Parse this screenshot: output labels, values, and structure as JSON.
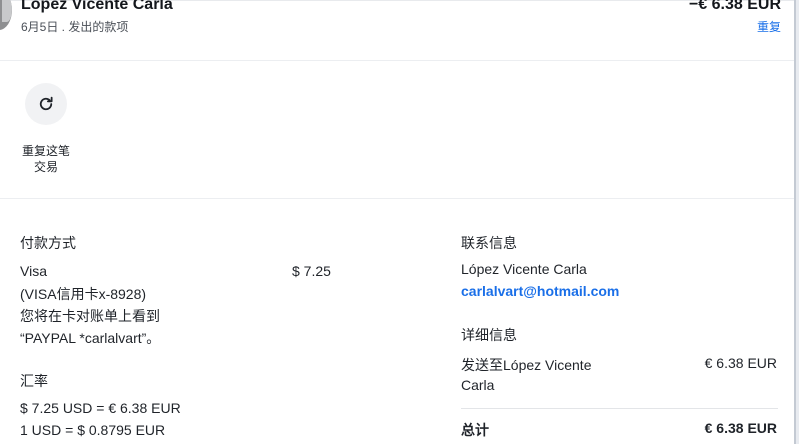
{
  "header": {
    "payee_name": "López Vicente Carla",
    "subtitle": "6月5日 . 发出的款项",
    "amount": "−€ 6.38 EUR",
    "repeat_link": "重复"
  },
  "actions": {
    "repeat_label_line1": "重复这笔",
    "repeat_label_line2": "交易",
    "repeat_icon": "refresh-icon"
  },
  "payment": {
    "heading": "付款方式",
    "method_name": "Visa",
    "card_line": "(VISA信用卡x-8928)",
    "statement_line1": "您将在卡对账单上看到",
    "statement_line2": "“PAYPAL *carlalvart”。",
    "amount": "$ 7.25"
  },
  "exchange": {
    "heading": "汇率",
    "line1": "$ 7.25 USD = € 6.38 EUR",
    "line2": "1 USD = $ 0.8795 EUR"
  },
  "contact": {
    "heading": "联系信息",
    "name": "López Vicente Carla",
    "email": "carlalvart@hotmail.com"
  },
  "details": {
    "heading": "详细信息",
    "sent_to_line1": "发送至López Vicente",
    "sent_to_line2": "Carla",
    "sent_amount": "€ 6.38 EUR",
    "total_label": "总计",
    "total_amount": "€ 6.38 EUR"
  },
  "colors": {
    "link": "#1a6fe8",
    "text": "#1f2329",
    "muted": "#4a4f57",
    "icon_bg": "#f1f2f4"
  }
}
